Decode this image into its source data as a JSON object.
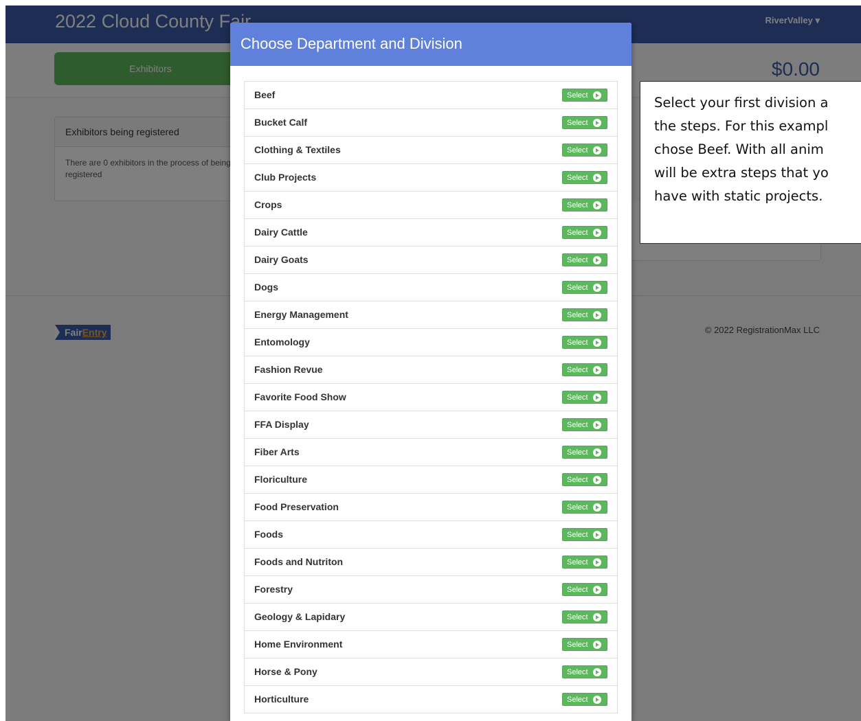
{
  "header": {
    "title": "2022 Cloud County Fair",
    "user_menu": "RiverValley ▾"
  },
  "subbar": {
    "exhibitors_tab": "Exhibitors",
    "total": "$0.00"
  },
  "panel": {
    "heading": "Exhibitors being registered",
    "body": "There are 0 exhibitors in the process of being registered"
  },
  "footer": {
    "logo_fair": "Fair",
    "logo_entry": "Entry",
    "copyright": "© 2022 RegistrationMax LLC"
  },
  "modal": {
    "title": "Choose Department and Division",
    "select_label": "Select",
    "divisions": [
      "Beef",
      "Bucket Calf",
      "Clothing & Textiles",
      "Club Projects",
      "Crops",
      "Dairy Cattle",
      "Dairy Goats",
      "Dogs",
      "Energy Management",
      "Entomology",
      "Fashion Revue",
      "Favorite Food Show",
      "FFA Display",
      "Fiber Arts",
      "Floriculture",
      "Food Preservation",
      "Foods",
      "Foods and Nutriton",
      "Forestry",
      "Geology & Lapidary",
      "Home Environment",
      "Horse & Pony",
      "Horticulture"
    ]
  },
  "callout": {
    "lines": [
      "Select your first division a",
      "the steps. For this exampl",
      "chose Beef. With all anim",
      "will be extra steps that yo",
      "have with static projects."
    ]
  }
}
